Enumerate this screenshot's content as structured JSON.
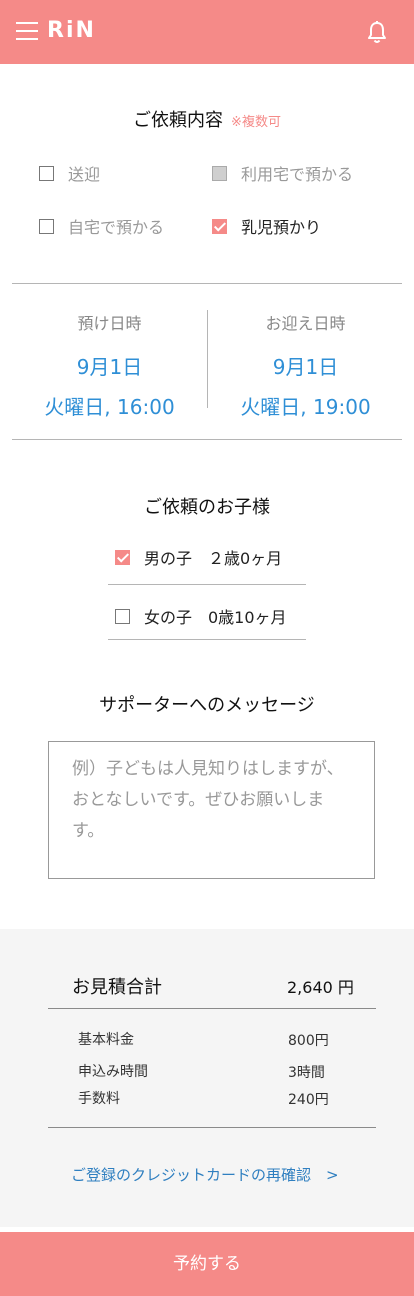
{
  "header": {
    "logo": "RiN",
    "accent_color": "#f58a88"
  },
  "request": {
    "title": "ご依頼内容",
    "note": "※複数可",
    "options": [
      {
        "label": "送迎",
        "state": "unchecked"
      },
      {
        "label": "利用宅で預かる",
        "state": "disabled"
      },
      {
        "label": "自宅で預かる",
        "state": "unchecked"
      },
      {
        "label": "乳児預かり",
        "state": "checked"
      }
    ]
  },
  "schedule": {
    "dropoff": {
      "label": "預け日時",
      "date": "9月1日",
      "time": "火曜日, 16:00"
    },
    "pickup": {
      "label": "お迎え日時",
      "date": "9月1日",
      "time": "火曜日, 19:00"
    }
  },
  "children": {
    "title": "ご依頼のお子様",
    "items": [
      {
        "label": "男の子　２歳0ヶ月",
        "checked": true
      },
      {
        "label": "女の子　0歳10ヶ月",
        "checked": false
      }
    ]
  },
  "message": {
    "title": "サポーターへのメッセージ",
    "placeholder": "例）子どもは人見知りはしますが、おとなしいです。ぜひお願いします。"
  },
  "estimate": {
    "title": "お見積合計",
    "total": "2,640 円",
    "rows": [
      {
        "label": "基本料金",
        "value": "800円"
      },
      {
        "label": "申込み時間",
        "value": "3時間"
      },
      {
        "label": "手数料",
        "value": "240円"
      }
    ],
    "card_link": "ご登録のクレジットカードの再確認　>"
  },
  "submit_label": "予約する"
}
